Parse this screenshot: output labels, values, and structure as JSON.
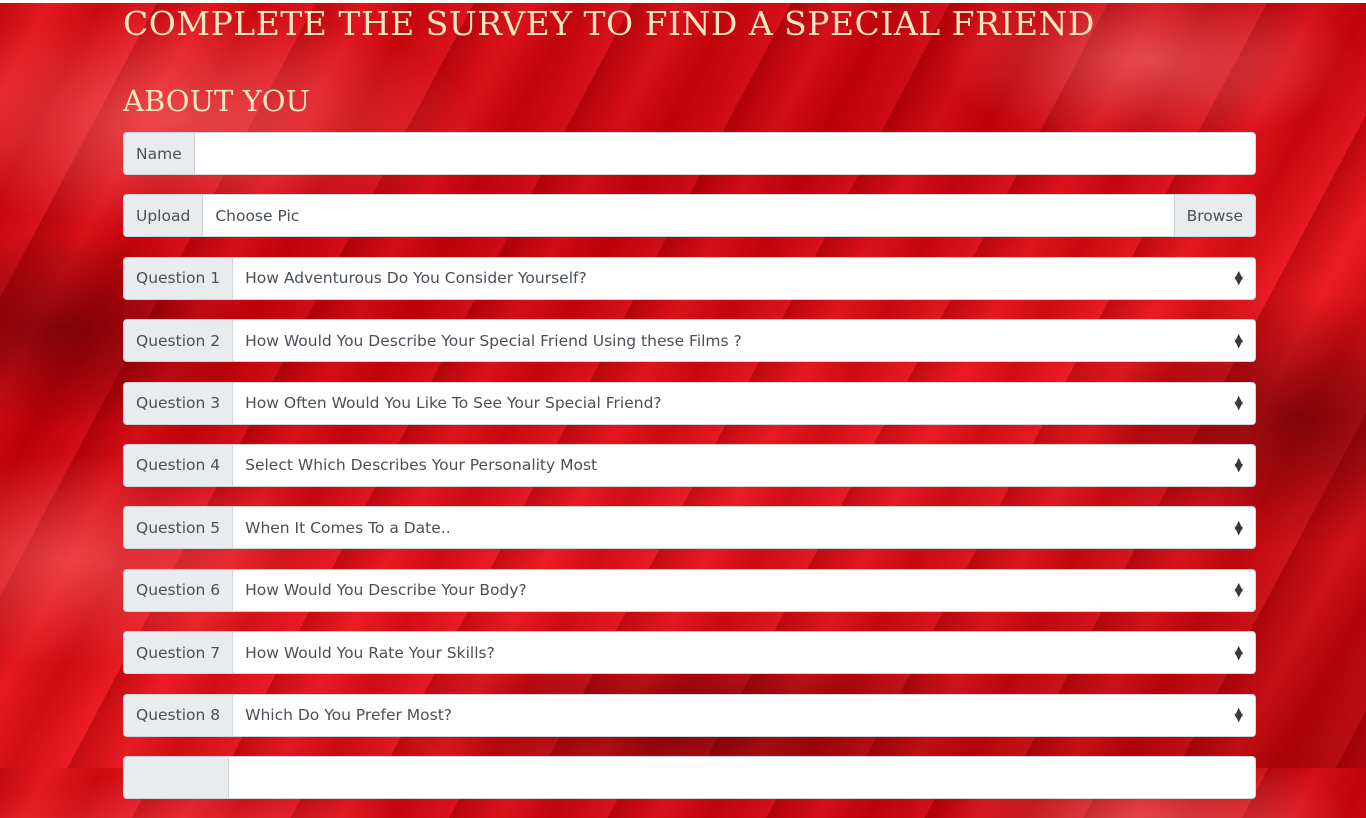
{
  "header": {
    "title": "COMPLETE THE SURVEY TO FIND A SPECIAL FRIEND",
    "section": "ABOUT YOU"
  },
  "name_field": {
    "label": "Name",
    "value": "",
    "placeholder": ""
  },
  "upload_field": {
    "label": "Upload",
    "placeholder": "Choose Pic",
    "button": "Browse"
  },
  "questions": [
    {
      "label": "Question 1",
      "selected": "How Adventurous Do You Consider Yourself?"
    },
    {
      "label": "Question 2",
      "selected": "How Would You Describe Your Special Friend Using these Films ?"
    },
    {
      "label": "Question 3",
      "selected": "How Often Would You Like To See Your Special Friend?"
    },
    {
      "label": "Question 4",
      "selected": "Select Which Describes Your Personality Most"
    },
    {
      "label": "Question 5",
      "selected": "When It Comes To a Date.."
    },
    {
      "label": "Question 6",
      "selected": "How Would You Describe Your Body?"
    },
    {
      "label": "Question 7",
      "selected": "How Would You Rate Your Skills?"
    },
    {
      "label": "Question 8",
      "selected": "Which Do You Prefer Most?"
    },
    {
      "label": "",
      "selected": ""
    }
  ],
  "colors": {
    "heading": "#f6e6c4",
    "background": "#c4000c"
  }
}
